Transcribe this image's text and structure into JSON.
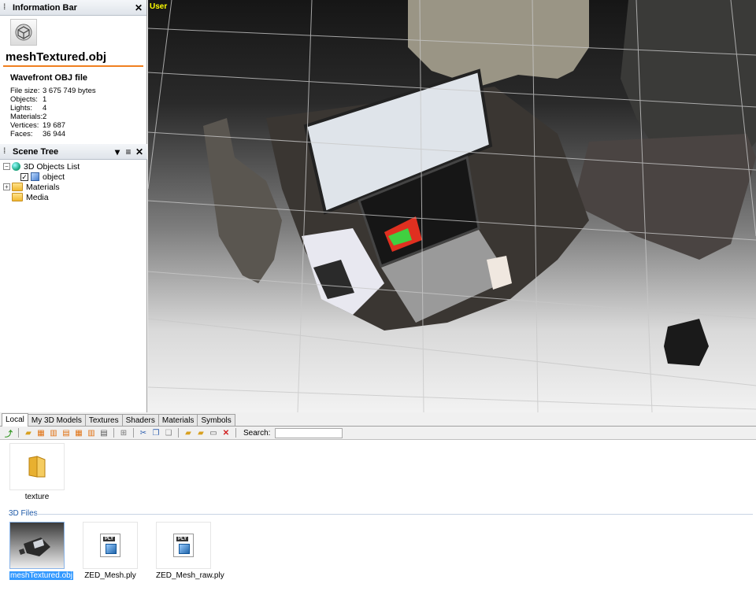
{
  "info_bar": {
    "title": "Information Bar",
    "file_name": "meshTextured.obj",
    "file_type": "Wavefront OBJ file",
    "stats": [
      {
        "key": "File size:",
        "value": "3 675 749 bytes"
      },
      {
        "key": "Objects:",
        "value": "1"
      },
      {
        "key": "Lights:",
        "value": "4"
      },
      {
        "key": "Materials:",
        "value": "2"
      },
      {
        "key": "Vertices:",
        "value": "19 687"
      },
      {
        "key": "Faces:",
        "value": "36 944"
      }
    ]
  },
  "scene_tree": {
    "title": "Scene Tree",
    "items": {
      "objects_list": "3D Objects List",
      "object": "object",
      "materials": "Materials",
      "media": "Media"
    }
  },
  "viewport": {
    "label": "User"
  },
  "browser": {
    "tabs": [
      "Local",
      "My 3D Models",
      "Textures",
      "Shaders",
      "Materials",
      "Symbols"
    ],
    "active_tab": "Local",
    "search_label": "Search:",
    "search_value": "",
    "folder": {
      "label": "texture"
    },
    "section_label": "3D Files",
    "files": [
      {
        "label": "meshTextured.obj",
        "selected": true
      },
      {
        "label": "ZED_Mesh.ply",
        "selected": false
      },
      {
        "label": "ZED_Mesh_raw.ply",
        "selected": false
      }
    ]
  },
  "colors": {
    "viewport_label": "#ffff00",
    "accent_underline": "#f08020",
    "selection": "#3399ff",
    "section_label": "#1f5aa8"
  }
}
